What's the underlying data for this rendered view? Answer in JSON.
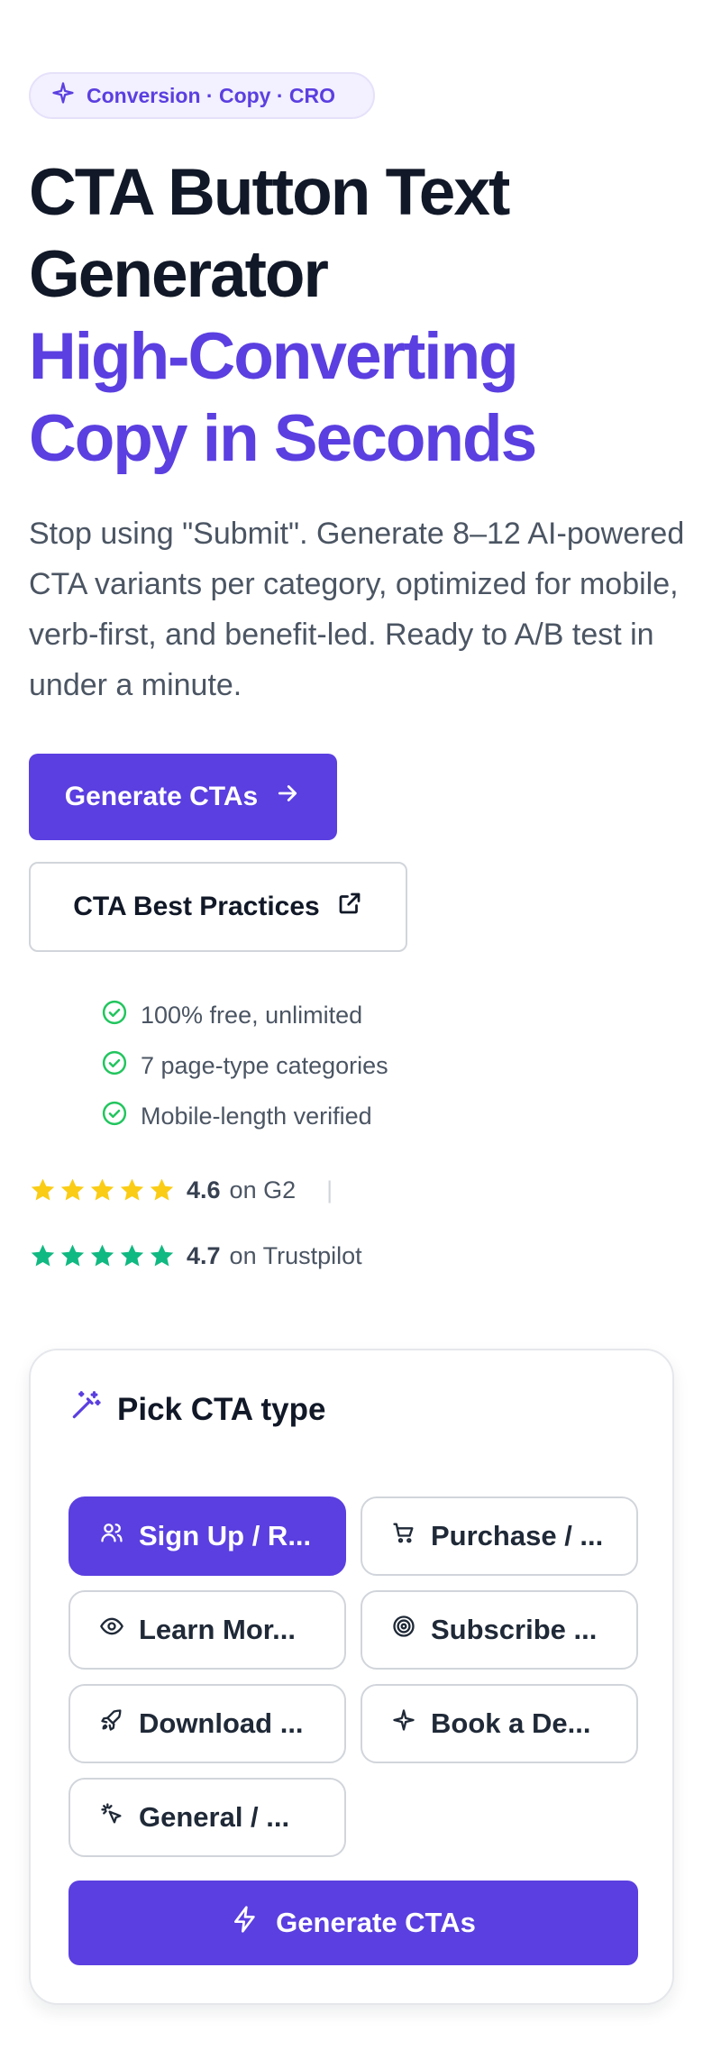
{
  "badge": {
    "text": "Conversion · Copy · CRO",
    "icon": "sparkle-icon"
  },
  "hero": {
    "title_line1": "CTA Button Text",
    "title_line2": "Generator",
    "title_accent1": "High-Converting",
    "title_accent2": "Copy in Seconds",
    "subtitle": "Stop using \"Submit\". Generate 8–12 AI-powered CTA variants per category, optimized for mobile, verb-first, and benefit-led. Ready to A/B test in under a minute."
  },
  "actions": {
    "primary_label": "Generate CTAs",
    "secondary_label": "CTA Best Practices"
  },
  "features": [
    "100% free, unlimited",
    "7 page-type categories",
    "Mobile-length verified"
  ],
  "ratings": [
    {
      "score": "4.6",
      "source": "on G2",
      "stars": 5,
      "color": "#facc15"
    },
    {
      "score": "4.7",
      "source": "on Trustpilot",
      "stars": 5,
      "color": "#10b981"
    }
  ],
  "separator": "|",
  "card": {
    "title": "Pick CTA type",
    "types": [
      {
        "label": "Sign Up / R...",
        "icon": "users-icon",
        "active": true
      },
      {
        "label": "Purchase / ...",
        "icon": "cart-icon",
        "active": false
      },
      {
        "label": "Learn Mor...",
        "icon": "eye-icon",
        "active": false
      },
      {
        "label": "Subscribe ...",
        "icon": "target-icon",
        "active": false
      },
      {
        "label": "Download ...",
        "icon": "rocket-icon",
        "active": false
      },
      {
        "label": "Book a De...",
        "icon": "sparkle-icon",
        "active": false
      },
      {
        "label": "General / ...",
        "icon": "cursor-click-icon",
        "active": false
      }
    ],
    "generate_label": "Generate CTAs"
  },
  "colors": {
    "accent": "#5b3fe0",
    "g2_star": "#facc15",
    "trustpilot_star": "#10b981",
    "check": "#22c55e"
  }
}
